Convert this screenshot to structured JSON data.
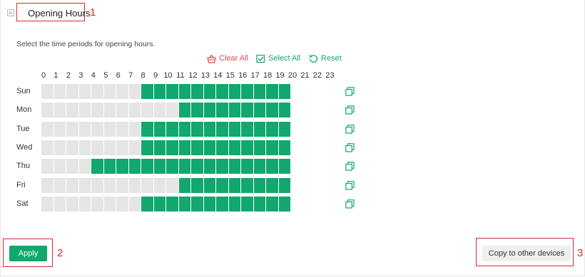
{
  "section": {
    "title": "Opening Hours",
    "collapse_symbol": "−",
    "instruction": "Select the time periods for opening hours."
  },
  "actions": {
    "clear_all": "Clear All",
    "select_all": "Select All",
    "reset": "Reset"
  },
  "hours": [
    "0",
    "1",
    "2",
    "3",
    "4",
    "5",
    "6",
    "7",
    "8",
    "9",
    "10",
    "11",
    "12",
    "13",
    "14",
    "15",
    "16",
    "17",
    "18",
    "19",
    "20",
    "21",
    "22",
    "23"
  ],
  "schedule": [
    {
      "day": "Sun",
      "start": 8,
      "end": 20
    },
    {
      "day": "Mon",
      "start": 11,
      "end": 20
    },
    {
      "day": "Tue",
      "start": 8,
      "end": 20
    },
    {
      "day": "Wed",
      "start": 8,
      "end": 20
    },
    {
      "day": "Thu",
      "start": 4,
      "end": 20
    },
    {
      "day": "Fri",
      "start": 11,
      "end": 20
    },
    {
      "day": "Sat",
      "start": 8,
      "end": 20
    }
  ],
  "buttons": {
    "apply": "Apply",
    "copy_to_other_devices": "Copy to other devices"
  },
  "annotations": [
    "1",
    "2",
    "3"
  ],
  "colors": {
    "accent_green": "#10a86c",
    "danger_red": "#e04a4a",
    "annotation_red": "#d62b2b",
    "empty_cell": "#e5e5e5"
  },
  "icons": {
    "clear_all": "basket-icon",
    "select_all": "checkbox-icon",
    "reset": "reset-icon",
    "copy_row": "copy-icon"
  }
}
